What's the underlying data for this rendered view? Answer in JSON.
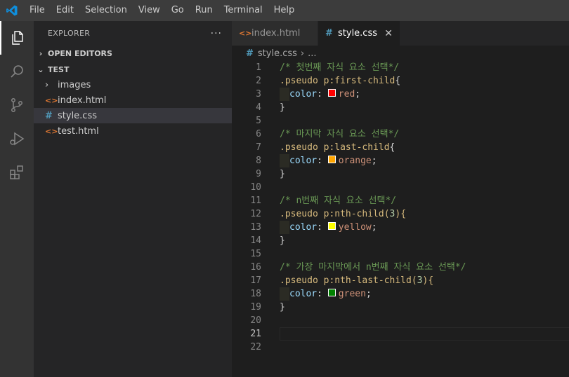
{
  "menu": [
    "File",
    "Edit",
    "Selection",
    "View",
    "Go",
    "Run",
    "Terminal",
    "Help"
  ],
  "sidebar": {
    "title": "EXPLORER",
    "more": "···",
    "open_editors": "OPEN EDITORS",
    "folder": "TEST",
    "items": [
      {
        "label": "images",
        "icon": "›"
      },
      {
        "label": "index.html",
        "icon": "<>"
      },
      {
        "label": "style.css",
        "icon": "#"
      },
      {
        "label": "test.html",
        "icon": "<>"
      }
    ]
  },
  "tabs": [
    {
      "label": "index.html",
      "icon": "<>"
    },
    {
      "label": "style.css",
      "icon": "#"
    }
  ],
  "breadcrumb": {
    "file": "style.css",
    "sep": "›",
    "rest": "..."
  },
  "code": {
    "l1": "/* 첫번째 자식 요소 선택*/",
    "l2s": ".pseudo p:first-child",
    "l2b": "{",
    "l3p": "color",
    "l3c": ": ",
    "l3v": "red",
    "l3e": ";",
    "l4": "}",
    "l6": "/* 마지막 자식 요소 선택*/",
    "l7s": ".pseudo p:last-child",
    "l7b": "{",
    "l8p": "color",
    "l8c": ": ",
    "l8v": "orange",
    "l8e": ";",
    "l9": "}",
    "l11": "/* n번째 자식 요소 선택*/",
    "l12s": ".pseudo p:nth-child(",
    "l12n": "3",
    "l12b": "){",
    "l13p": "color",
    "l13c": ": ",
    "l13v": "yellow",
    "l13e": ";",
    "l14": "}",
    "l16": "/* 가장 마지막에서 n번째 자식 요소 선택*/",
    "l17s": ".pseudo p:nth-last-child(",
    "l17n": "3",
    "l17b": "){",
    "l18p": "color",
    "l18c": ": ",
    "l18v": "green",
    "l18e": ";",
    "l19": "}"
  },
  "line_numbers": [
    "1",
    "2",
    "3",
    "4",
    "5",
    "6",
    "7",
    "8",
    "9",
    "10",
    "11",
    "12",
    "13",
    "14",
    "15",
    "16",
    "17",
    "18",
    "19",
    "20",
    "21",
    "22"
  ],
  "swatch_colors": {
    "red": "#ff0000",
    "orange": "#ffa500",
    "yellow": "#ffff00",
    "green": "#008000"
  },
  "colors": {
    "accent": "#007acc",
    "html_icon": "#e37933",
    "css_icon": "#519aba"
  }
}
